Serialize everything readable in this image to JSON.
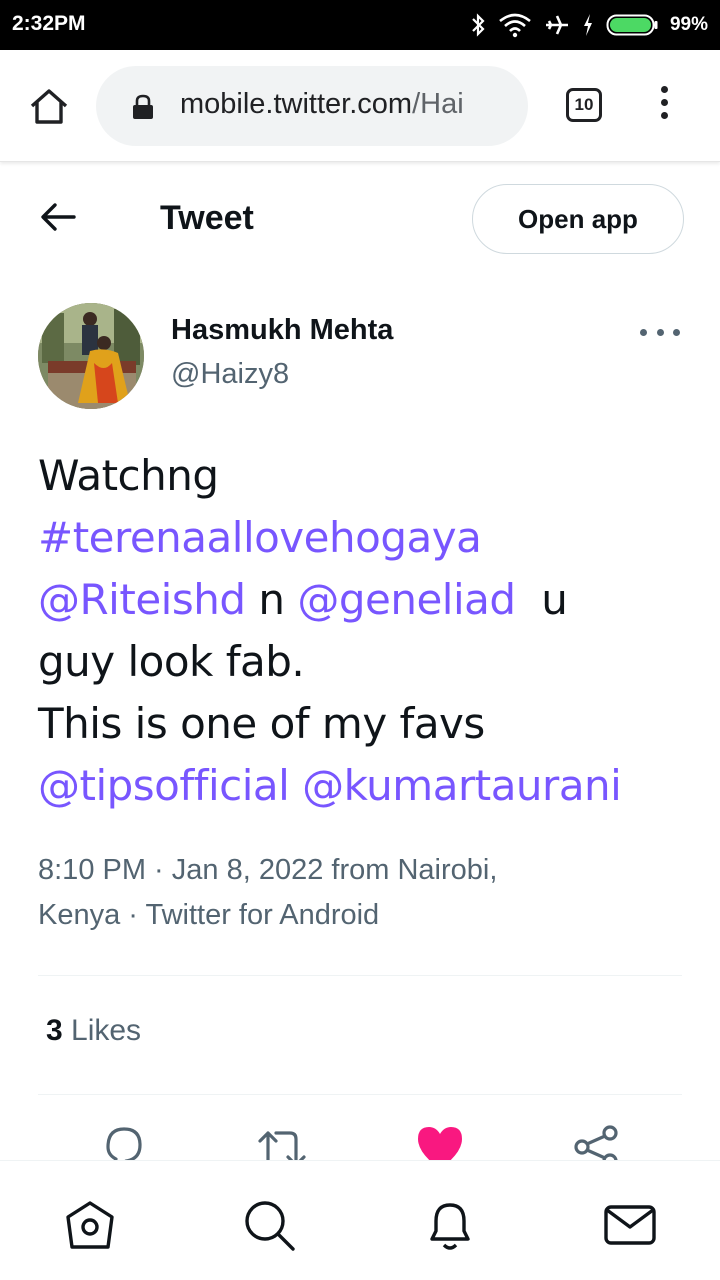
{
  "status_bar": {
    "time": "2:32PM",
    "battery": "99%"
  },
  "browser": {
    "url_host": "mobile.twitter.com",
    "url_path": "/Hai",
    "tab_count": "10"
  },
  "header": {
    "title": "Tweet",
    "open_app_label": "Open app"
  },
  "tweet": {
    "author_name": "Hasmukh Mehta",
    "author_handle": "@Haizy8",
    "text_line1": "Watchng",
    "hashtag": "#terenaallovehogaya",
    "mention1": "@Riteishd",
    "joiner": " n ",
    "mention2": "@geneliad",
    "after_mention2": "  u",
    "text_line4": "guy look fab.",
    "text_line5": "This is one of my favs",
    "mention3": "@tipsofficial",
    "mention4": "@kumartaurani",
    "meta_line1": "8:10 PM · Jan 8, 2022 from Nairobi,",
    "meta_line2": "Kenya · Twitter for Android",
    "likes_count": "3",
    "likes_label": " Likes",
    "liked": true
  },
  "colors": {
    "link": "#7856ff",
    "like": "#f91880",
    "battery_fill": "#4cd964"
  },
  "icons": {
    "status": [
      "bluetooth-icon",
      "wifi-icon",
      "airplane-icon",
      "charging-icon",
      "battery-icon"
    ],
    "actions": [
      "reply-icon",
      "retweet-icon",
      "like-icon",
      "share-icon"
    ],
    "nav": [
      "home-icon",
      "search-icon",
      "notifications-icon",
      "messages-icon"
    ]
  }
}
